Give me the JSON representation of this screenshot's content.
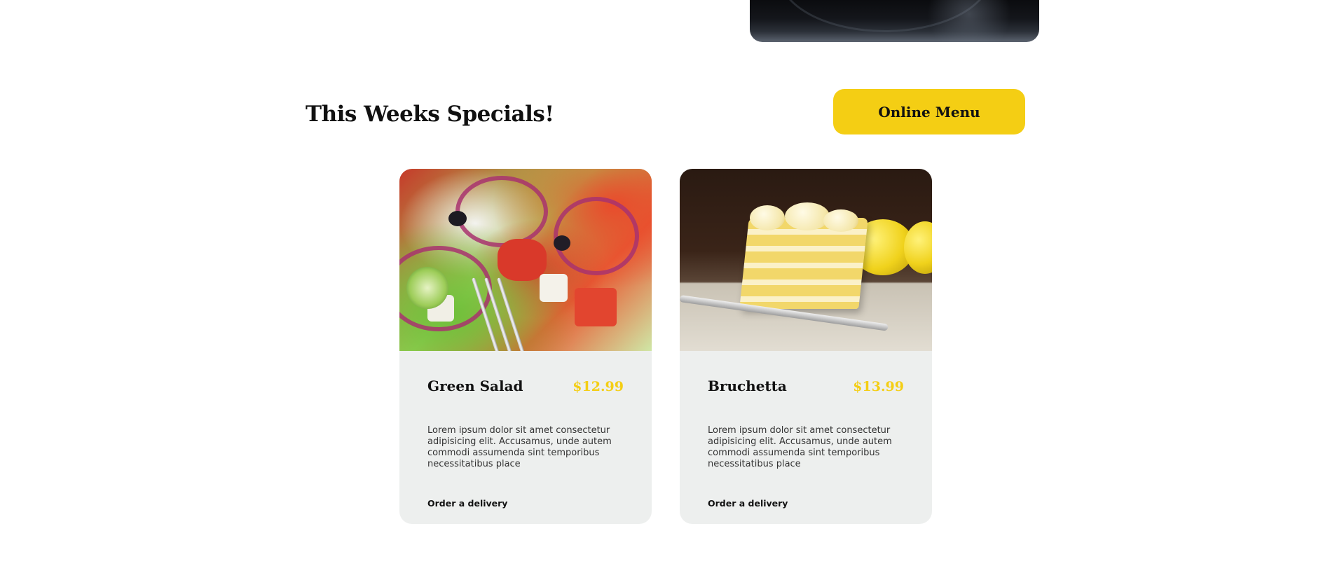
{
  "specials": {
    "title": "This Weeks Specials!",
    "online_menu_label": "Online Menu"
  },
  "cards": [
    {
      "name": "Green Salad",
      "price": "$12.99",
      "description": "Lorem ipsum dolor sit amet consectetur adipisicing elit. Accusamus, unde autem commodi assumenda sint temporibus necessitatibus place",
      "order_label": "Order a delivery"
    },
    {
      "name": "Bruchetta",
      "price": "$13.99",
      "description": "Lorem ipsum dolor sit amet consectetur adipisicing elit. Accusamus, unde autem commodi assumenda sint temporibus necessitatibus place",
      "order_label": "Order a delivery"
    }
  ],
  "colors": {
    "accent": "#f4ce14",
    "card_background": "#edefee",
    "text": "#111111"
  }
}
